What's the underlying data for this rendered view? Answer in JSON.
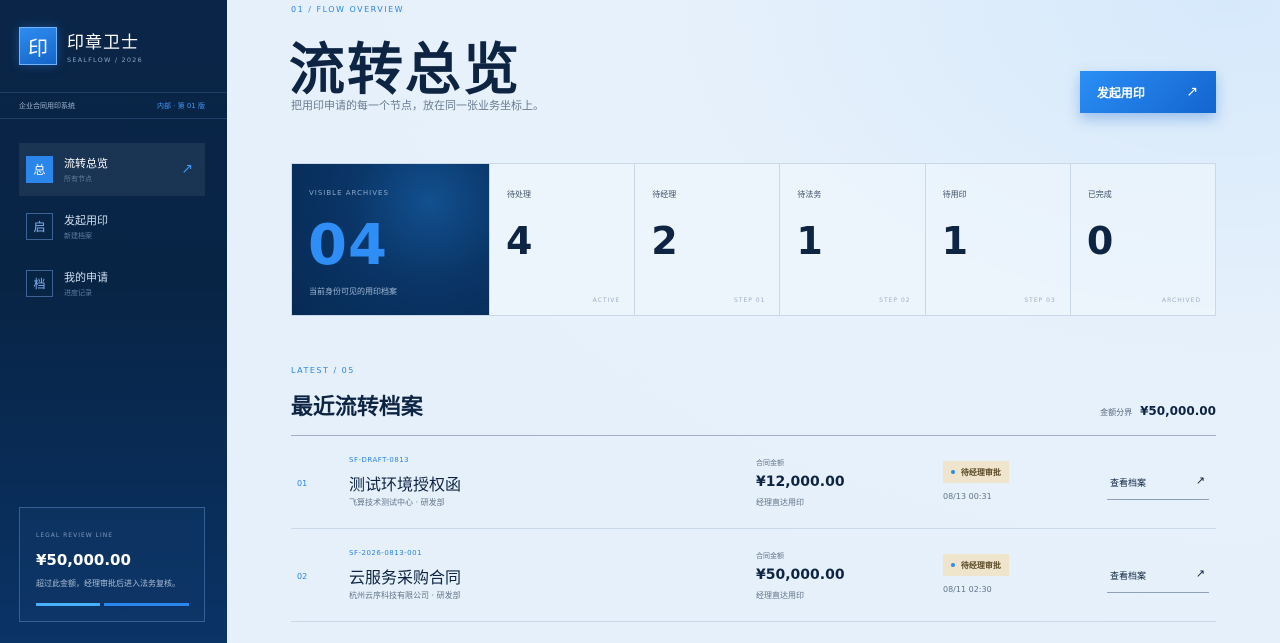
{
  "brand": {
    "mark": "印",
    "name": "印章卫士",
    "sub": "SEALFLOW / 2026"
  },
  "system": {
    "name": "企业合同用印系统",
    "version": "内部 · 第 01 版"
  },
  "nav": [
    {
      "icon_char": "总",
      "label": "流转总览",
      "sub": "所有节点",
      "arrow": "↗",
      "active": true
    },
    {
      "icon_char": "启",
      "label": "发起用印",
      "sub": "新建档案",
      "active": false
    },
    {
      "icon_char": "档",
      "label": "我的申请",
      "sub": "进度记录",
      "active": false
    }
  ],
  "legal": {
    "title": "LEGAL REVIEW LINE",
    "amount": "¥50,000.00",
    "note": "超过此金额，经理审批后进入法务复核。"
  },
  "header": {
    "eyebrow": "01 / FLOW OVERVIEW",
    "title": "流转总览",
    "subtitle": "把用印申请的每一个节点，放在同一张业务坐标上。",
    "start_button": "发起用印",
    "start_arrow": "↗"
  },
  "stats": {
    "hero": {
      "label": "VISIBLE ARCHIVES",
      "value": "04",
      "note": "当前身份可见的用印档案"
    },
    "cells": [
      {
        "label": "待处理",
        "value": "4",
        "tag": "ACTIVE"
      },
      {
        "label": "待经理",
        "value": "2",
        "tag": "STEP 01"
      },
      {
        "label": "待法务",
        "value": "1",
        "tag": "STEP 02"
      },
      {
        "label": "待用印",
        "value": "1",
        "tag": "STEP 03"
      },
      {
        "label": "已完成",
        "value": "0",
        "tag": "ARCHIVED"
      }
    ]
  },
  "latest": {
    "eyebrow": "LATEST / 05",
    "title": "最近流转档案",
    "threshold_label": "金额分界",
    "threshold_value": "¥50,000.00",
    "rows": [
      {
        "index": "01",
        "code": "SF-DRAFT-0813",
        "title": "测试环境授权函",
        "org": "飞算技术测试中心 · 研发部",
        "amount_label": "合同金额",
        "amount": "¥12,000.00",
        "route": "经理直达用印",
        "status": "待经理审批",
        "time": "08/13 00:31",
        "link": "查看档案",
        "link_arrow": "↗"
      },
      {
        "index": "02",
        "code": "SF-2026-0813-001",
        "title": "云服务采购合同",
        "org": "杭州云序科技有限公司 · 研发部",
        "amount_label": "合同金额",
        "amount": "¥50,000.00",
        "route": "经理直达用印",
        "status": "待经理审批",
        "time": "08/11 02:30",
        "link": "查看档案",
        "link_arrow": "↗"
      }
    ]
  },
  "colors": {
    "accent": "#2a86ea",
    "sidebar": "#082445",
    "status_bg": "#efe4cc"
  }
}
